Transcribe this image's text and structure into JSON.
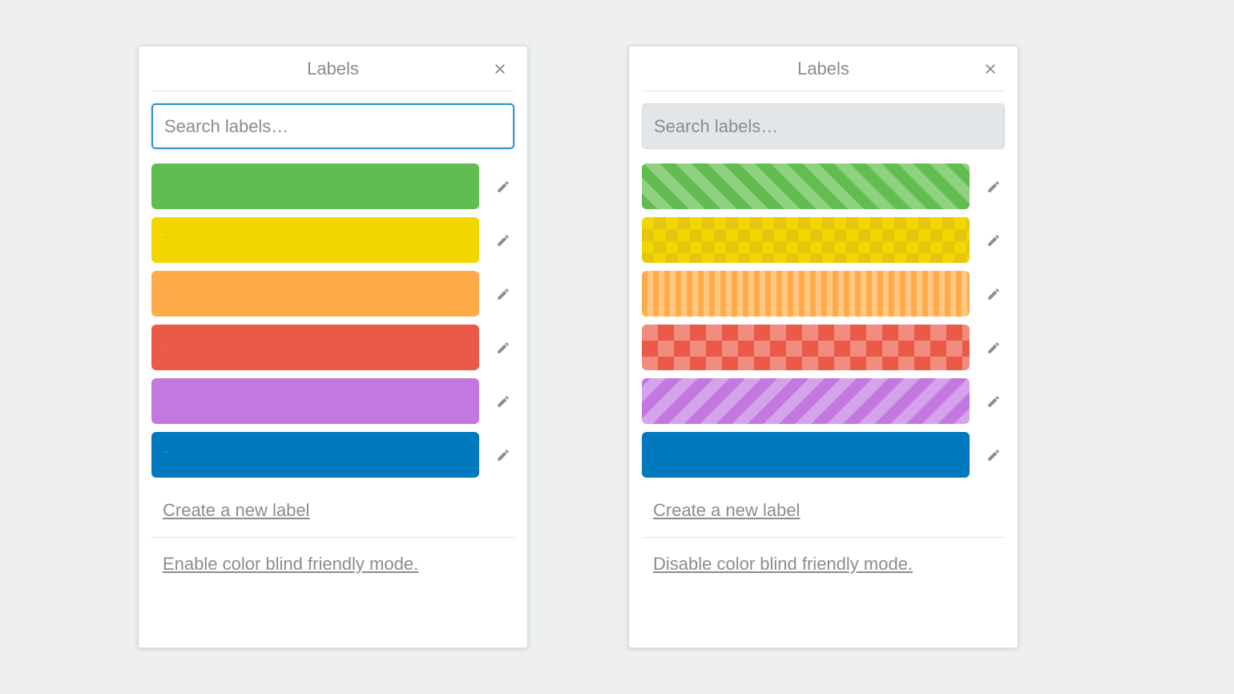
{
  "panel_left": {
    "title": "Labels",
    "search_placeholder": "Search labels…",
    "search_focused": true,
    "labels": [
      {
        "name": "green",
        "color": "#61bd4f"
      },
      {
        "name": "yellow",
        "color": "#f2d600"
      },
      {
        "name": "orange",
        "color": "#ffab4a"
      },
      {
        "name": "red",
        "color": "#eb5a46"
      },
      {
        "name": "purple",
        "color": "#c377e0"
      },
      {
        "name": "blue",
        "color": "#0079bf"
      }
    ],
    "create_label_link": "Create a new label",
    "toggle_link": "Enable color blind friendly mode."
  },
  "panel_right": {
    "title": "Labels",
    "search_placeholder": "Search labels…",
    "search_focused": false,
    "labels": [
      {
        "name": "green",
        "color": "#61bd4f",
        "pattern": "diagonal-forward"
      },
      {
        "name": "yellow",
        "color": "#f2d600",
        "pattern": "diamond-small"
      },
      {
        "name": "orange",
        "color": "#ffab4a",
        "pattern": "vertical-stripes"
      },
      {
        "name": "red",
        "color": "#eb5a46",
        "pattern": "diamond-large"
      },
      {
        "name": "purple",
        "color": "#c377e0",
        "pattern": "diagonal-back"
      },
      {
        "name": "blue",
        "color": "#0079bf",
        "pattern": "solid"
      }
    ],
    "create_label_link": "Create a new label",
    "toggle_link": "Disable color blind friendly mode."
  },
  "icons": {
    "close": "✕",
    "pencil": "✎"
  }
}
